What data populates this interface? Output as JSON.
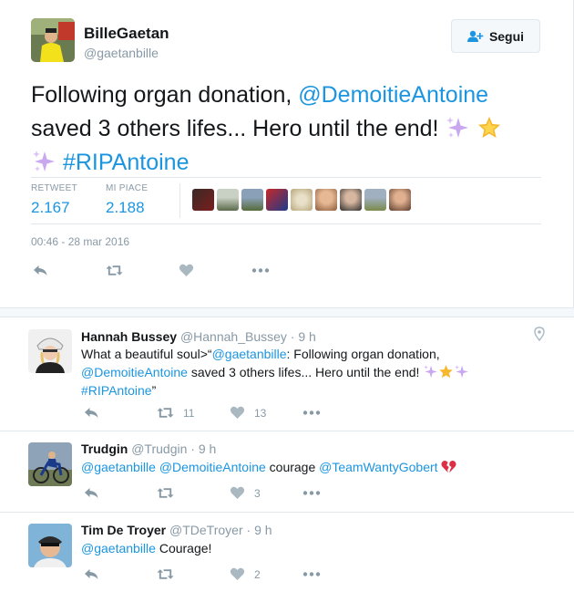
{
  "main_tweet": {
    "author_name": "BilleGaetan",
    "author_handle": "@gaetanbille",
    "follow_label": "Segui",
    "text_prefix": "Following organ donation, ",
    "mention": "@DemoitieAntoine",
    "text_middle": " saved 3 others lifes... Hero until the end! ",
    "hashtag": "#RIPAntoine",
    "emojis": [
      "sparkles",
      "glowing-star",
      "sparkles"
    ],
    "retweets_label": "RETWEET",
    "retweets_value": "2.167",
    "likes_label": "MI PIACE",
    "likes_value": "2.188",
    "timestamp": "00:46 - 28 mar 2016",
    "liker_count_shown": 9
  },
  "replies": [
    {
      "name": "Hannah Bussey",
      "handle": "@Hannah_Bussey",
      "time": "9 h",
      "text_prefix": "What a beautiful soul>“",
      "mention1": "@gaetanbille",
      "text_a": ": Following organ donation,",
      "mention2": "@DemoitieAntoine",
      "text_b": " saved 3 others lifes... Hero until the end! ",
      "hashtag": "#RIPAntoine",
      "text_end": "”",
      "retweets": "11",
      "likes": "13"
    },
    {
      "name": "Trudgin",
      "handle": "@Trudgin",
      "time": "9 h",
      "mention1": "@gaetanbille",
      "mention2": "@DemoitieAntoine",
      "text_a": " courage ",
      "mention3": "@TeamWantyGobert",
      "retweets": "",
      "likes": "3"
    },
    {
      "name": "Tim De Troyer",
      "handle": "@TDeTroyer",
      "time": "9 h",
      "mention1": "@gaetanbille",
      "text_a": " Courage!",
      "retweets": "",
      "likes": "2"
    }
  ],
  "colors": {
    "link": "#1b95e0",
    "muted": "#8899a6",
    "border": "#e1e8ed",
    "text": "#14171a"
  }
}
